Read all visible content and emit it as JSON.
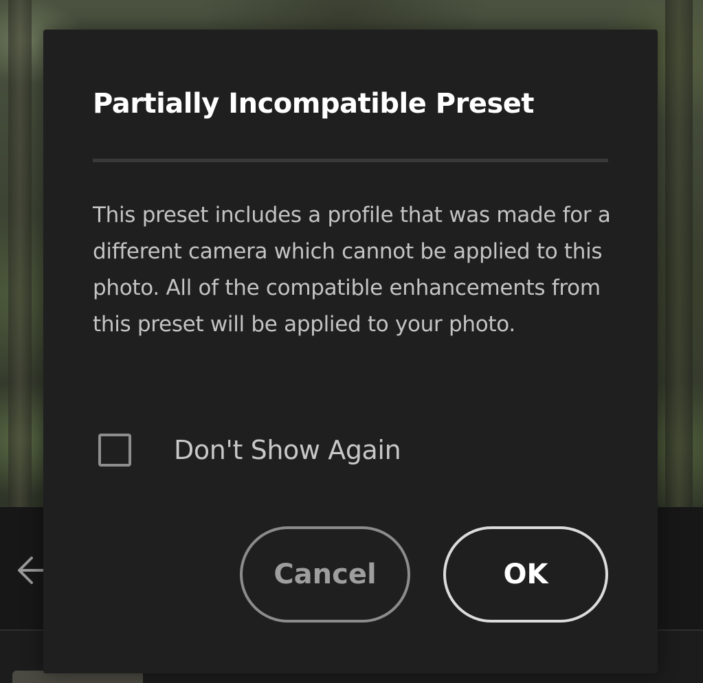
{
  "dialog": {
    "title": "Partially Incompatible Preset",
    "message": "This preset includes a profile that was made for a different camera which cannot be applied to this photo. All of the compatible enhancements from this preset will be applied to your photo.",
    "checkbox": {
      "label": "Don't Show Again",
      "checked": false
    },
    "buttons": {
      "cancel_label": "Cancel",
      "ok_label": "OK"
    }
  },
  "background": {
    "back_icon": "arrow-left-icon"
  },
  "colors": {
    "dialog_bg": "#1f1f1f",
    "title_text": "#ffffff",
    "body_text": "#c4c4c4",
    "cancel_border": "#8c8c8c",
    "ok_border": "#dcdcdc"
  }
}
